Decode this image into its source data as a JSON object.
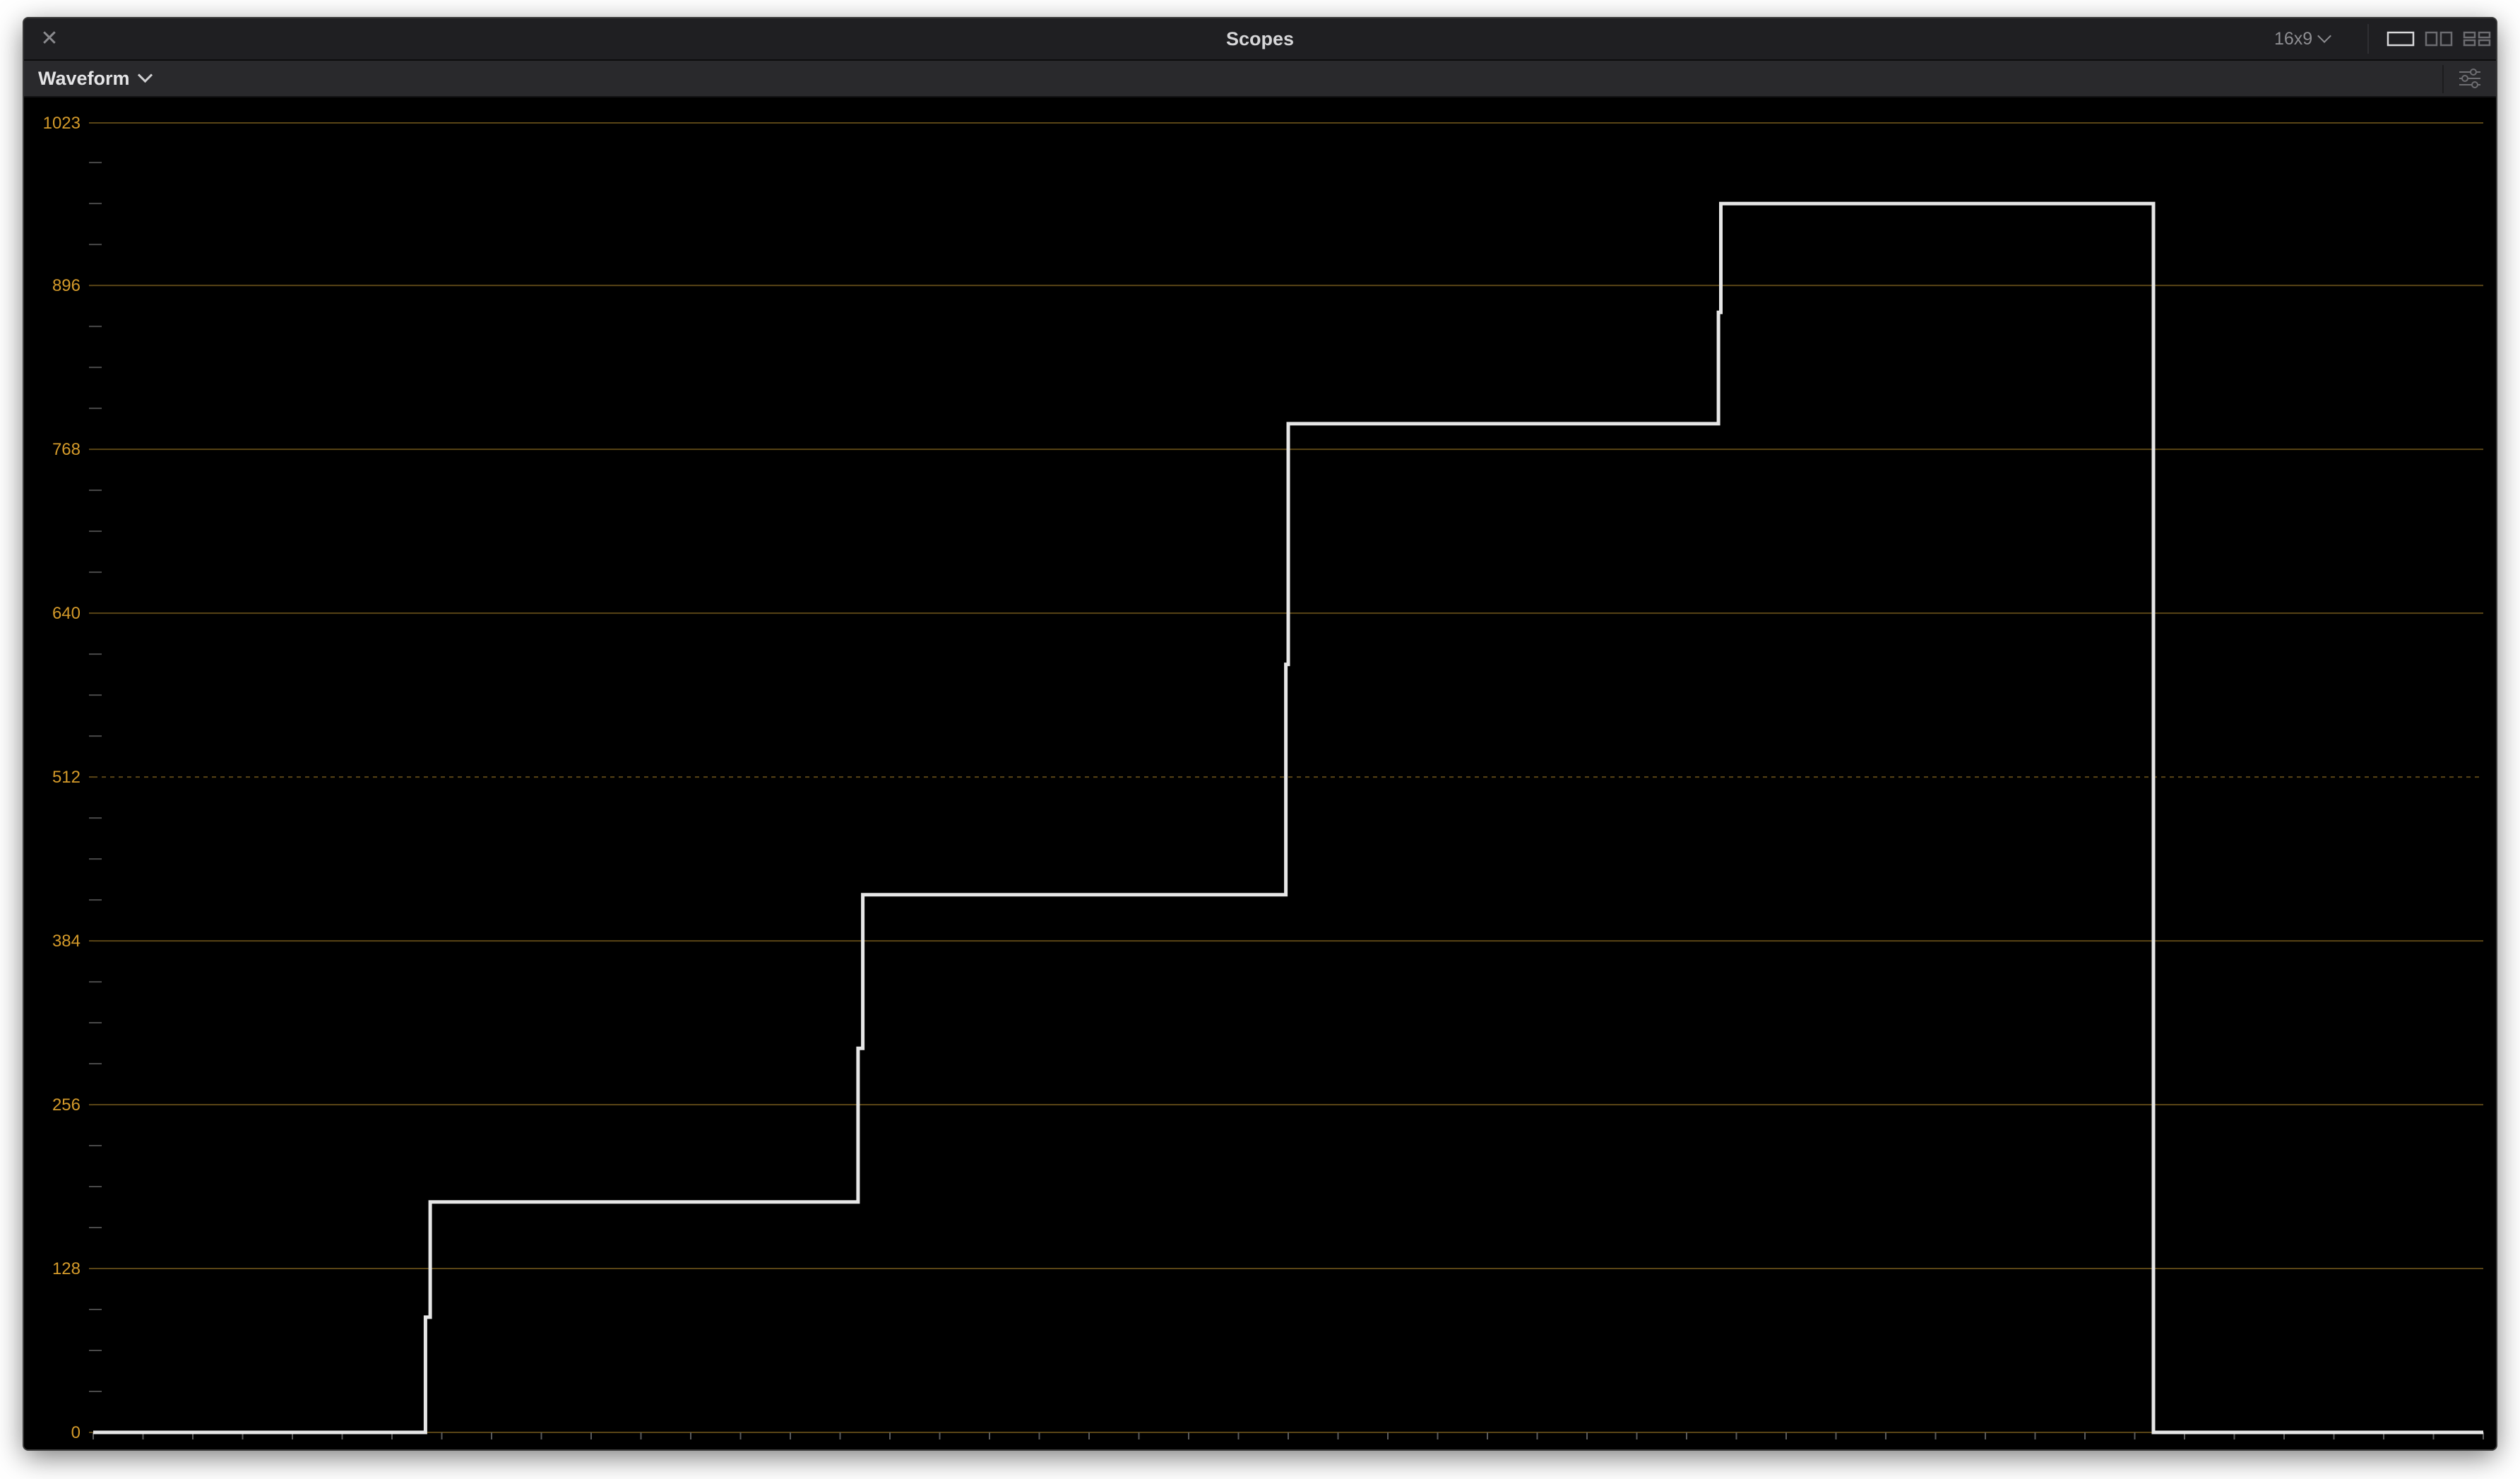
{
  "window": {
    "title": "Scopes",
    "close_glyph": "✕",
    "aspect_label": "16x9",
    "layout_buttons": [
      {
        "name": "single-view-layout-icon",
        "active": true
      },
      {
        "name": "dual-view-layout-icon",
        "active": false
      },
      {
        "name": "quad-view-layout-icon",
        "active": false
      }
    ]
  },
  "toolbar": {
    "mode_label": "Waveform",
    "settings_icon": "sliders-icon"
  },
  "colors": {
    "scale_label": "#d49a2a",
    "graticule_line": "#5a4516",
    "trace": "#e6e6e6",
    "background": "#000000"
  },
  "chart_data": {
    "type": "line",
    "y_ticks": [
      0,
      128,
      256,
      384,
      512,
      640,
      768,
      896,
      1023
    ],
    "y_tick_labels": [
      "0",
      "128",
      "256",
      "384",
      "512",
      "640",
      "768",
      "896",
      "1023"
    ],
    "ylim": [
      0,
      1023
    ],
    "xlim": [
      0,
      1
    ],
    "dashed_ticks": [
      512
    ],
    "minor_tick_step": 32,
    "x_tick_count": 48,
    "series": [
      {
        "points": [
          [
            0.0,
            0
          ],
          [
            0.139,
            0
          ],
          [
            0.139,
            90
          ],
          [
            0.141,
            90
          ],
          [
            0.141,
            180
          ],
          [
            0.32,
            180
          ],
          [
            0.32,
            300
          ],
          [
            0.322,
            300
          ],
          [
            0.322,
            420
          ],
          [
            0.499,
            420
          ],
          [
            0.499,
            600
          ],
          [
            0.5,
            600
          ],
          [
            0.5,
            788
          ],
          [
            0.68,
            788
          ],
          [
            0.68,
            875
          ],
          [
            0.681,
            875
          ],
          [
            0.681,
            960
          ],
          [
            0.862,
            960
          ],
          [
            0.862,
            0
          ],
          [
            1.0,
            0
          ]
        ]
      }
    ]
  }
}
